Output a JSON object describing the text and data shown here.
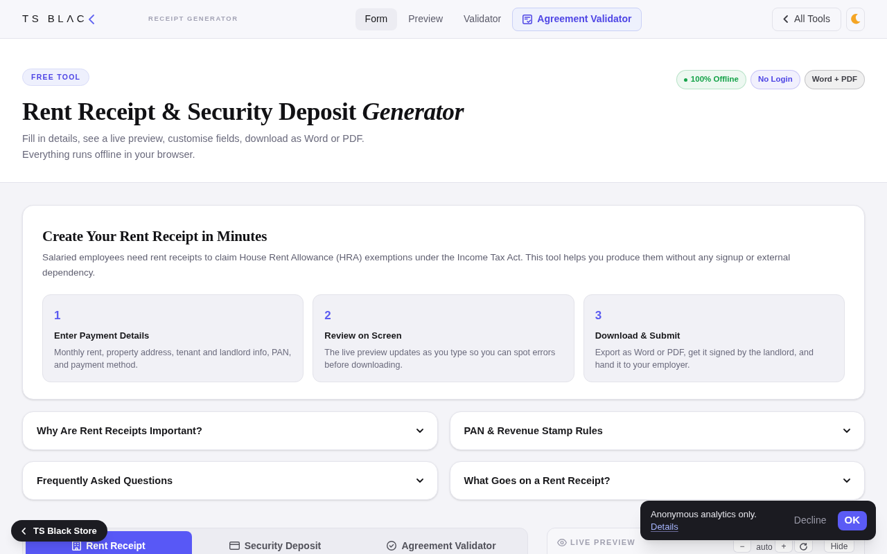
{
  "header": {
    "logo": "TS BLΛC",
    "app_label": "RECEIPT GENERATOR",
    "nav": [
      {
        "label": "Form",
        "kind": "tab",
        "selected": true
      },
      {
        "label": "Preview",
        "kind": "tab",
        "selected": false
      },
      {
        "label": "Validator",
        "kind": "tab",
        "selected": false
      },
      {
        "label": "Agreement Validator",
        "kind": "highlight",
        "selected": false
      }
    ],
    "all_tools": "All Tools"
  },
  "hero": {
    "badge": "FREE TOOL",
    "title": "Rent Receipt & Security Deposit *Generator*",
    "description": [
      "Fill in details, see a live preview, customise fields, download as Word or PDF.",
      "Everything runs offline in your browser."
    ],
    "tags": [
      {
        "label": "100% Offline",
        "color": "#16a34a",
        "dot": true
      },
      {
        "label": "No Login",
        "color": "#4f46e5",
        "dot": false
      },
      {
        "label": "Word + PDF",
        "color": "#3f3f46",
        "dot": false
      }
    ]
  },
  "intro": {
    "title": "Create Your Rent Receipt in Minutes",
    "description": "Salaried employees need rent receipts to claim House Rent Allowance (HRA) exemptions under the Income Tax Act. This tool helps you produce them without any signup or external dependency.",
    "steps": [
      {
        "number": "1",
        "title": "Enter Payment Details",
        "description": "Monthly rent, property address, tenant and landlord info, PAN, and payment method."
      },
      {
        "number": "2",
        "title": "Review on Screen",
        "description": "The live preview updates as you type so you can spot errors before downloading."
      },
      {
        "number": "3",
        "title": "Download & Submit",
        "description": "Export as Word or PDF, get it signed by the landlord, and hand it to your employer."
      }
    ]
  },
  "sections": [
    {
      "title": "Why Are Rent Receipts Important?",
      "expanded": false
    },
    {
      "title": "PAN & Revenue Stamp Rules",
      "expanded": false
    },
    {
      "title": "Frequently Asked Questions",
      "expanded": false
    },
    {
      "title": "What Goes on a Rent Receipt?",
      "expanded": false
    }
  ],
  "mode_tabs": [
    {
      "label": "Rent Receipt",
      "selected": true
    },
    {
      "label": "Security Deposit",
      "selected": false
    },
    {
      "label": "Agreement Validator",
      "selected": false
    }
  ],
  "live_preview": {
    "title": "LIVE PREVIEW",
    "zoom_out": "−",
    "zoom": "auto",
    "zoom_in": "+",
    "hide": "Hide"
  },
  "store_link": "TS Black Store",
  "cookie_notice": {
    "message": "Anonymous analytics only.",
    "details": "Details",
    "decline": "Decline",
    "accept": "OK"
  }
}
